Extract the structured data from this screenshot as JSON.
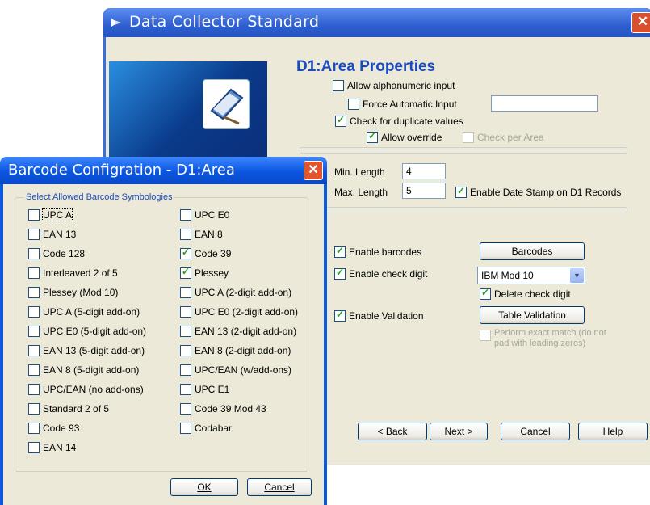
{
  "main_window": {
    "title": "Data Collector Standard",
    "section_title": "D1:Area Properties",
    "options": {
      "allow_alphanumeric": {
        "label": "Allow alphanumeric input",
        "checked": false
      },
      "force_automatic": {
        "label": "Force Automatic Input",
        "checked": false
      },
      "check_duplicates": {
        "label": "Check for duplicate values",
        "checked": true
      },
      "allow_override": {
        "label": "Allow override",
        "checked": true
      },
      "check_per_area": {
        "label": "Check per Area",
        "checked": false
      }
    },
    "min_length": {
      "label": "Min. Length",
      "value": "4"
    },
    "max_length": {
      "label": "Max. Length",
      "value": "5"
    },
    "enable_date_stamp": {
      "label": "Enable Date Stamp on D1 Records",
      "checked": true
    },
    "enable_barcodes": {
      "label": "Enable barcodes",
      "checked": true
    },
    "barcodes_button": "Barcodes",
    "enable_check_digit": {
      "label": "Enable check digit",
      "checked": true
    },
    "check_digit_select": "IBM Mod 10",
    "delete_check_digit": {
      "label": "Delete check digit",
      "checked": true
    },
    "enable_validation": {
      "label": "Enable Validation",
      "checked": true
    },
    "table_validation_button": "Table Validation",
    "exact_match": {
      "label_line1": "Perform exact match (do not",
      "label_line2": "pad with leading zeros)",
      "checked": false
    },
    "footer_buttons": {
      "back": "< Back",
      "next": "Next >",
      "cancel": "Cancel",
      "help": "Help"
    }
  },
  "dialog": {
    "title": "Barcode Configration - D1:Area",
    "group_label": "Select Allowed Barcode Symbologies",
    "left_column": [
      {
        "label": "UPC A",
        "checked": false
      },
      {
        "label": "EAN 13",
        "checked": false
      },
      {
        "label": "Code 128",
        "checked": false
      },
      {
        "label": "Interleaved 2 of 5",
        "checked": false
      },
      {
        "label": "Plessey (Mod 10)",
        "checked": false
      },
      {
        "label": "UPC A (5-digit add-on)",
        "checked": false
      },
      {
        "label": "UPC E0 (5-digit add-on)",
        "checked": false
      },
      {
        "label": "EAN 13 (5-digit add-on)",
        "checked": false
      },
      {
        "label": "EAN 8 (5-digit add-on)",
        "checked": false
      },
      {
        "label": "UPC/EAN (no add-ons)",
        "checked": false
      },
      {
        "label": "Standard 2 of 5",
        "checked": false
      },
      {
        "label": "Code 93",
        "checked": false
      },
      {
        "label": "EAN 14",
        "checked": false
      }
    ],
    "right_column": [
      {
        "label": "UPC E0",
        "checked": false
      },
      {
        "label": "EAN 8",
        "checked": false
      },
      {
        "label": "Code 39",
        "checked": true
      },
      {
        "label": "Plessey",
        "checked": true
      },
      {
        "label": "UPC A (2-digit add-on)",
        "checked": false
      },
      {
        "label": "UPC E0 (2-digit add-on)",
        "checked": false
      },
      {
        "label": "EAN 13 (2-digit add-on)",
        "checked": false
      },
      {
        "label": "EAN 8 (2-digit add-on)",
        "checked": false
      },
      {
        "label": "UPC/EAN (w/add-ons)",
        "checked": false
      },
      {
        "label": "UPC E1",
        "checked": false
      },
      {
        "label": "Code 39 Mod 43",
        "checked": false
      },
      {
        "label": "Codabar",
        "checked": false
      }
    ],
    "ok_button": "OK",
    "cancel_button": "Cancel"
  }
}
